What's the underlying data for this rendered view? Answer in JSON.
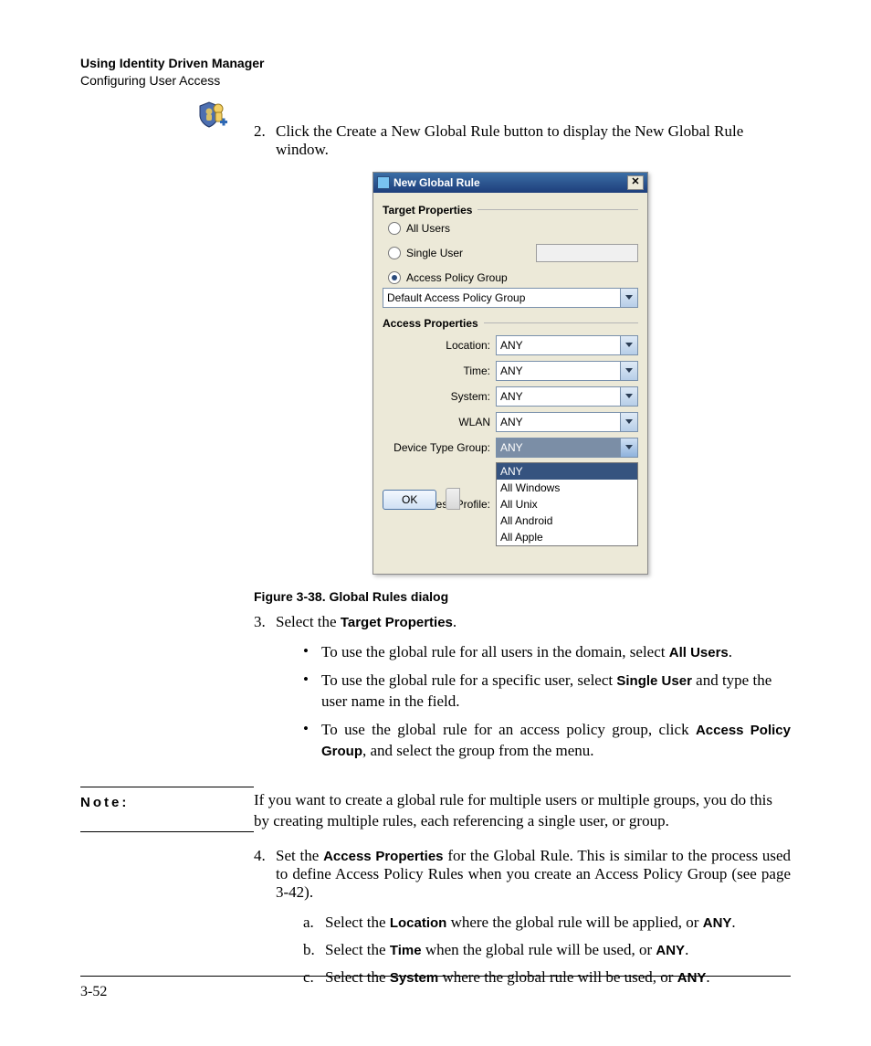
{
  "header": {
    "title": "Using Identity Driven Manager",
    "subtitle": "Configuring User Access"
  },
  "icon_name": "shield-user-add-icon",
  "steps": {
    "s2": {
      "num": "2.",
      "text": "Click the Create a New Global Rule button to display the New Global Rule window."
    },
    "s3": {
      "num": "3.",
      "pre": "Select the ",
      "bold": "Target Properties",
      "post": "."
    },
    "s4": {
      "num": "4.",
      "pre": "Set the ",
      "bold": "Access Properties",
      "post": " for the Global Rule. This is similar to the process used to define Access Policy Rules when you create an Access Policy Group (see page 3-42)."
    }
  },
  "dialog": {
    "title": "New Global Rule",
    "section1": "Target Properties",
    "radios": {
      "all": "All Users",
      "single": "Single User",
      "group": "Access Policy Group"
    },
    "policy_value": "Default Access Policy Group",
    "section2": "Access Properties",
    "rows": {
      "location": {
        "label": "Location:",
        "value": "ANY"
      },
      "time": {
        "label": "Time:",
        "value": "ANY"
      },
      "system": {
        "label": "System:",
        "value": "ANY"
      },
      "wlan": {
        "label": "WLAN",
        "value": "ANY"
      },
      "devtype": {
        "label": "Device Type Group:",
        "value": "ANY"
      },
      "profile": {
        "label": "Access Profile:"
      }
    },
    "dropdown": {
      "opt0": "ANY",
      "opt1": "All Windows",
      "opt2": "All Unix",
      "opt3": "All Android",
      "opt4": "All Apple"
    },
    "ok": "OK"
  },
  "caption": "Figure 3-38. Global Rules dialog",
  "bullets": {
    "b1": {
      "pre": "To use the global rule for all users in the domain, select ",
      "bold": "All Users",
      "post": "."
    },
    "b2": {
      "pre": "To use the global rule for a specific user, select ",
      "bold": "Single User",
      "post": " and type the user name in the field."
    },
    "b3": {
      "pre": "To use the global rule for an access policy group, click ",
      "bold": "Access Policy Group",
      "post": ", and select the group from the menu."
    }
  },
  "note": {
    "label": "Note:",
    "body": "If you want to create a global rule for multiple users or multiple groups, you do this by creating multiple rules, each referencing a single user, or group."
  },
  "substeps": {
    "a": {
      "n": "a.",
      "pre": "Select the ",
      "bold": "Location",
      "mid": " where the global rule will be applied, or ",
      "bold2": "ANY",
      "post": "."
    },
    "b": {
      "n": "b.",
      "pre": "Select the ",
      "bold": "Time",
      "mid": " when the global rule will be used, or ",
      "bold2": "ANY",
      "post": "."
    },
    "c": {
      "n": "c.",
      "pre": "Select the ",
      "bold": "System",
      "mid": " where the global rule will be used, or ",
      "bold2": "ANY",
      "post": "."
    }
  },
  "footer": {
    "page": "3-52"
  }
}
